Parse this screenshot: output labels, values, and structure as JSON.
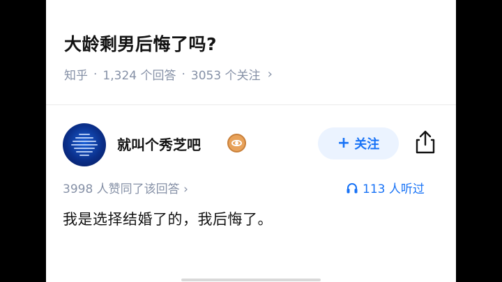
{
  "question": {
    "title": "大龄剩男后悔了吗?",
    "source": "知乎",
    "answers": "1,324 个回答",
    "followers": "3053 个关注",
    "separator": "·",
    "chevron": "›"
  },
  "answer": {
    "author_name": "就叫个秀芝吧",
    "avatar_icon": "avatar-image",
    "badge_icon": "eye-badge-icon",
    "follow_plus": "+",
    "follow_label": "关注",
    "share_icon": "share-icon",
    "likes": "3998 人赞同了该回答",
    "likes_chevron": "›",
    "listeners_icon": "headphones-icon",
    "listeners": "113 人听过",
    "content": "我是选择结婚了的，我后悔了。"
  },
  "colors": {
    "accent": "#1772f6",
    "muted": "#8590a6",
    "text": "#121212",
    "follow_bg": "#ebf3ff",
    "badge": "#e8a25a"
  }
}
